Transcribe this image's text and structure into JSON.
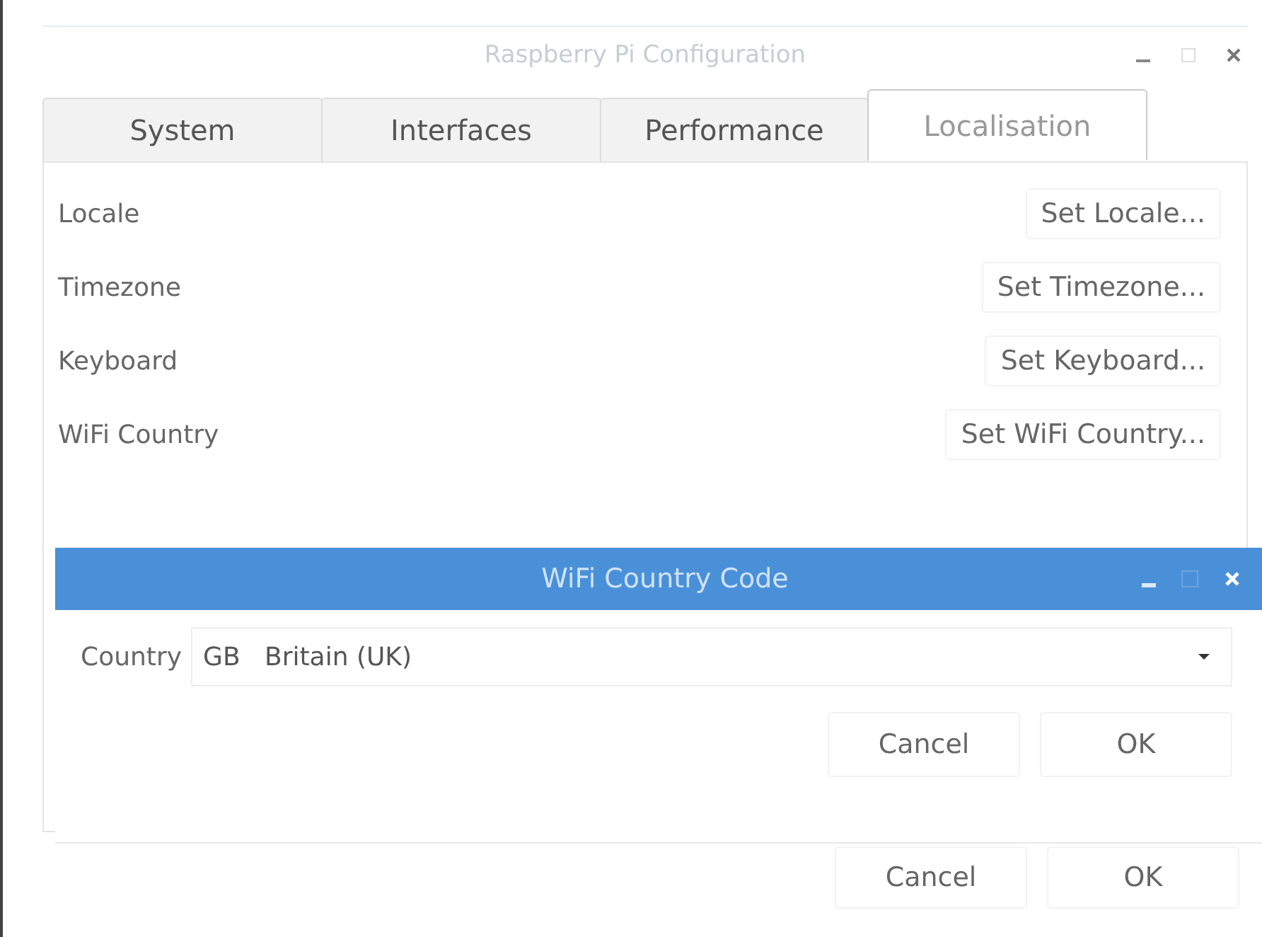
{
  "window": {
    "title": "Raspberry Pi Configuration",
    "active": false
  },
  "tabs": [
    {
      "label": "System",
      "selected": false
    },
    {
      "label": "Interfaces",
      "selected": false
    },
    {
      "label": "Performance",
      "selected": false
    },
    {
      "label": "Localisation",
      "selected": true
    }
  ],
  "settings": [
    {
      "label": "Locale",
      "button": "Set Locale..."
    },
    {
      "label": "Timezone",
      "button": "Set Timezone..."
    },
    {
      "label": "Keyboard",
      "button": "Set Keyboard..."
    },
    {
      "label": "WiFi Country",
      "button": "Set WiFi Country..."
    }
  ],
  "dialog": {
    "title": "WiFi Country Code",
    "active": true,
    "field_label": "Country",
    "value": "GB   Britain (UK)",
    "buttons": [
      "Cancel",
      "OK"
    ]
  },
  "buttons": [
    "Cancel",
    "OK"
  ]
}
